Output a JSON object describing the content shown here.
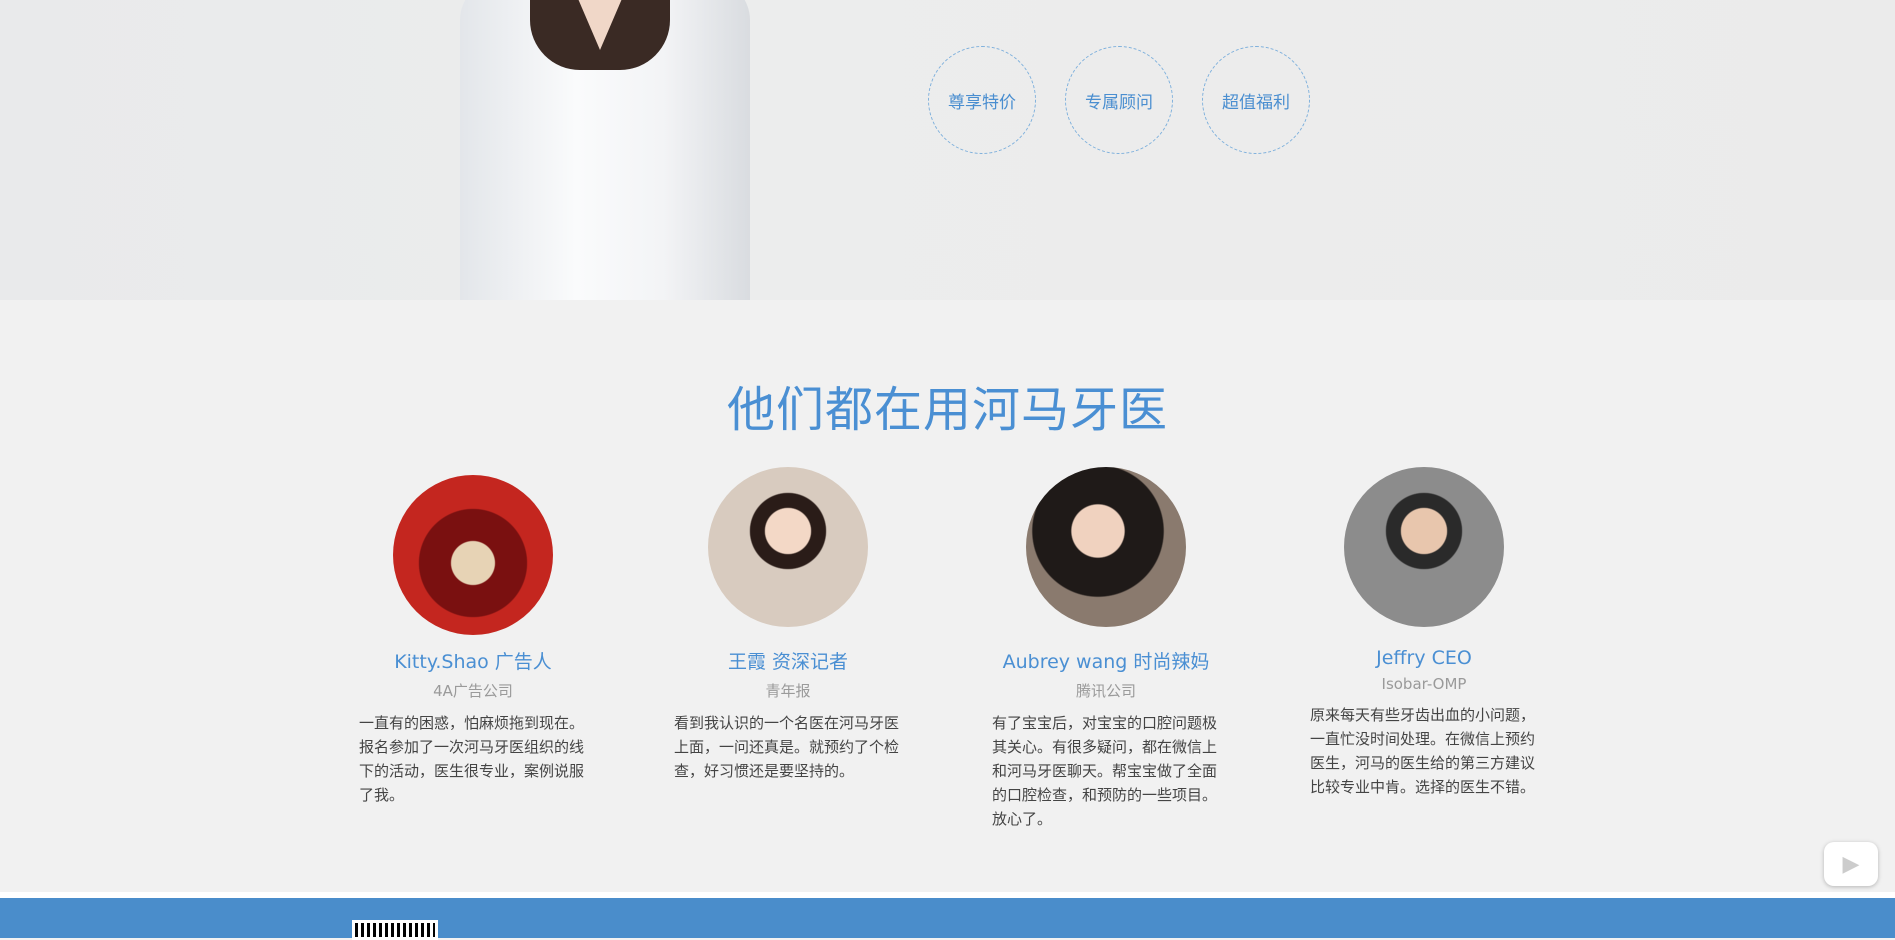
{
  "hero": {
    "badges": [
      "尊享特价",
      "专属顾问",
      "超值福利"
    ]
  },
  "testimonials": {
    "title": "他们都在用河马牙医",
    "items": [
      {
        "name": "Kitty.Shao 广告人",
        "company": "4A广告公司",
        "quote": "一直有的困惑，怕麻烦拖到现在。报名参加了一次河马牙医组织的线下的活动，医生很专业，案例说服了我。",
        "avatar_color": "#b51c1c"
      },
      {
        "name": "王霞  资深记者",
        "company": "青年报",
        "quote": "看到我认识的一个名医在河马牙医上面，一问还真是。就预约了个检查，好习惯还是要坚持的。",
        "avatar_color": "#c9b7a7"
      },
      {
        "name": "Aubrey wang  时尚辣妈",
        "company": "腾讯公司",
        "quote": "有了宝宝后，对宝宝的口腔问题极其关心。有很多疑问，都在微信上和河马牙医聊天。帮宝宝做了全面的口腔检查，和预防的一些项目。放心了。",
        "avatar_color": "#6f5a4c"
      },
      {
        "name": "Jeffry  CEO",
        "company": "Isobar-OMP",
        "quote": "原来每天有些牙齿出血的小问题，一直忙没时间处理。在微信上预约医生，河马的医生给的第三方建议比较专业中肯。选择的医生不错。",
        "avatar_color": "#6b6b6b"
      }
    ]
  },
  "colors": {
    "accent": "#4a8fd3",
    "footer": "#4a8dcb"
  },
  "floating": {
    "icon": "video-play-icon"
  }
}
